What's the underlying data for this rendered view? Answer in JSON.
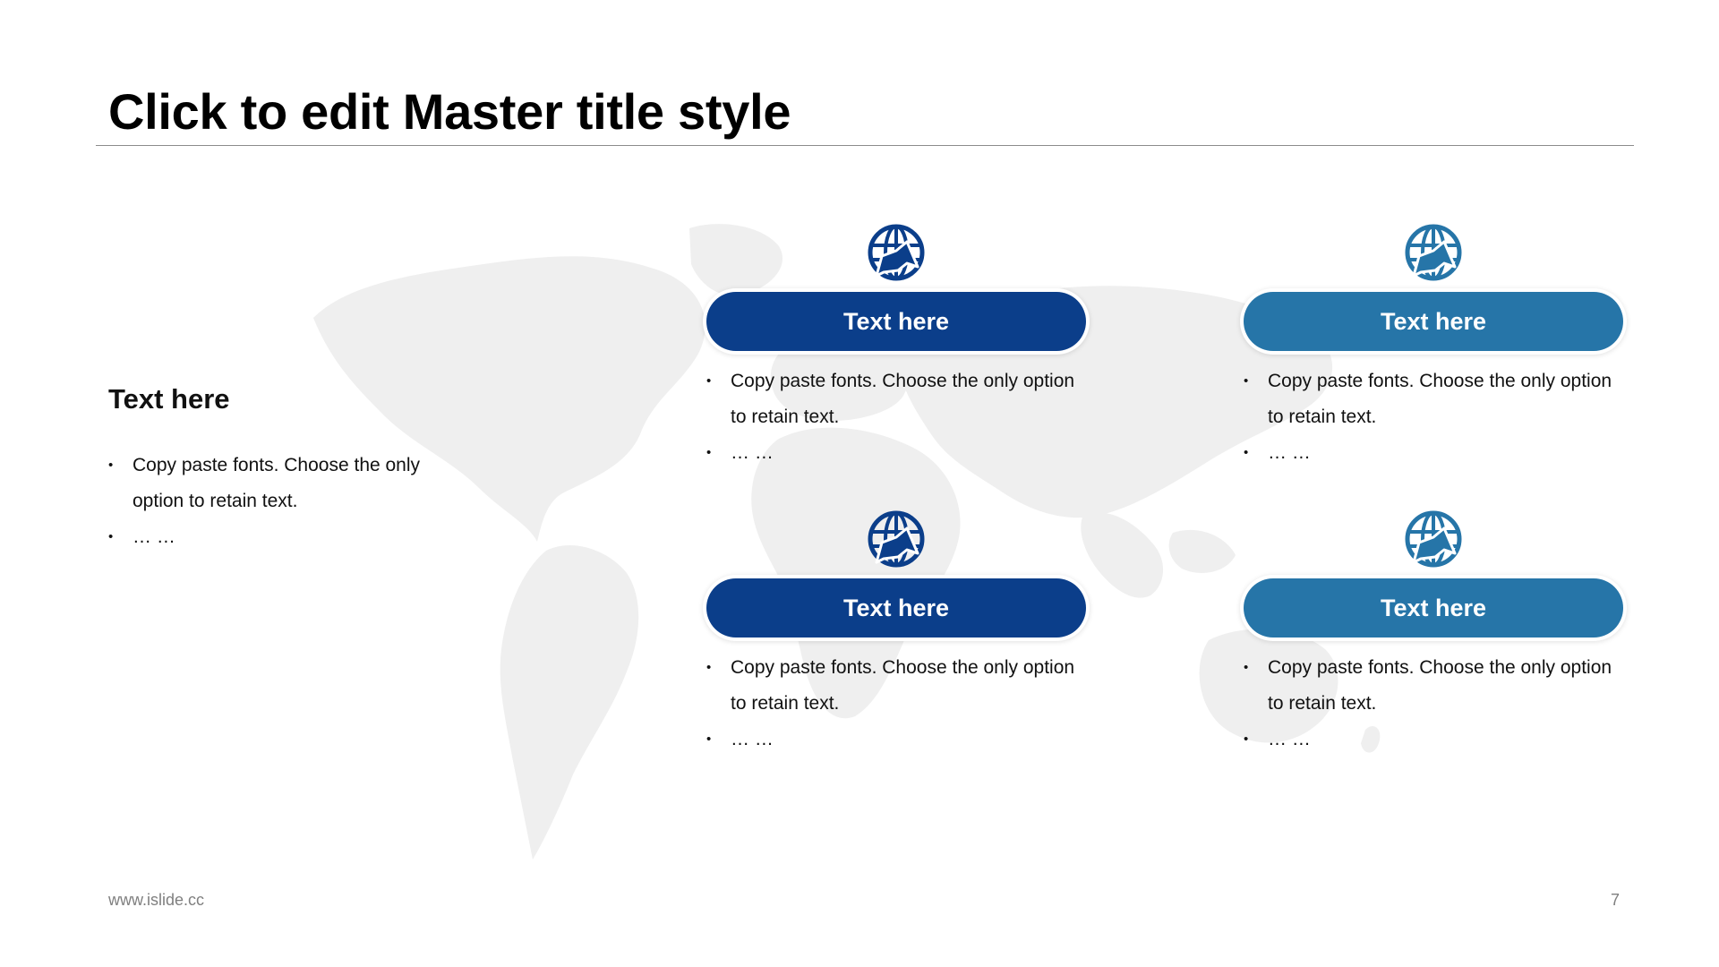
{
  "slide": {
    "title": "Click to edit Master title style",
    "footer_url": "www.islide.cc",
    "page_number": "7"
  },
  "colors": {
    "dark_blue": "#0b3e8a",
    "mid_blue": "#2675a8",
    "map_gray": "#efefef",
    "rule": "#8c8c8c"
  },
  "left_panel": {
    "heading": "Text here",
    "bullets": [
      "Copy paste fonts. Choose the only option to retain text.",
      "… …"
    ]
  },
  "cards": [
    {
      "label": "Text here",
      "icon": "globe-arrow-icon",
      "color": "#0b3e8a",
      "bullets": [
        "Copy paste fonts. Choose the only option to retain text.",
        "… …"
      ]
    },
    {
      "label": "Text here",
      "icon": "globe-arrow-icon",
      "color": "#2675a8",
      "bullets": [
        "Copy paste fonts. Choose the only option to retain text.",
        "… …"
      ]
    },
    {
      "label": "Text here",
      "icon": "globe-arrow-icon",
      "color": "#0b3e8a",
      "bullets": [
        "Copy paste fonts. Choose the only option to retain text.",
        "… …"
      ]
    },
    {
      "label": "Text here",
      "icon": "globe-arrow-icon",
      "color": "#2675a8",
      "bullets": [
        "Copy paste fonts. Choose the only option to retain text.",
        "… …"
      ]
    }
  ]
}
